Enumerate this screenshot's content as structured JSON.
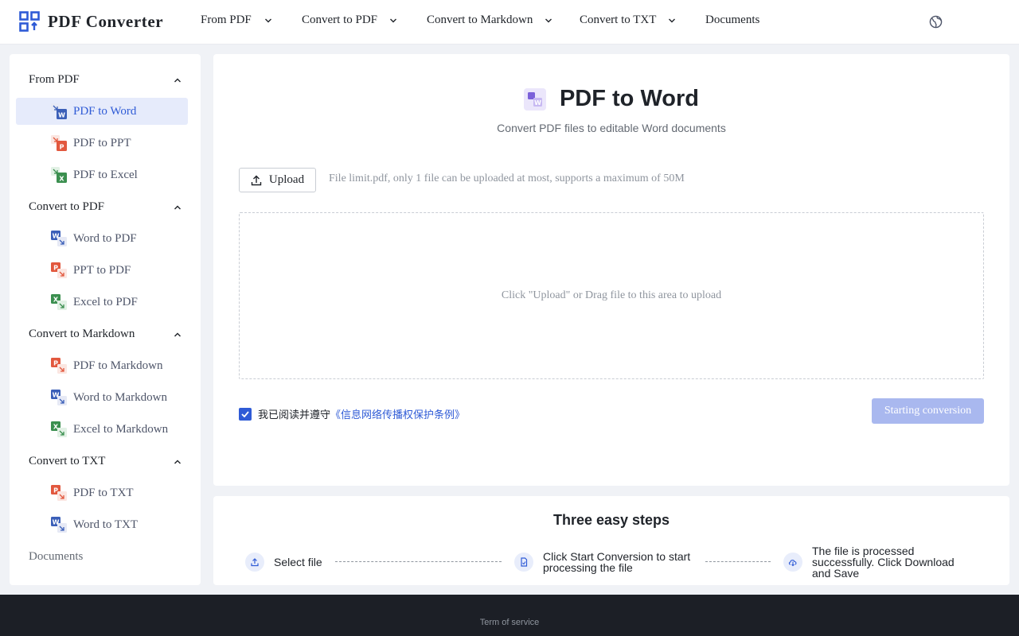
{
  "app": {
    "name": "PDF Converter"
  },
  "header": {
    "nav": [
      {
        "label": "From PDF",
        "has_dropdown": true
      },
      {
        "label": "Convert to PDF",
        "has_dropdown": true
      },
      {
        "label": "Convert to Markdown",
        "has_dropdown": true
      },
      {
        "label": "Convert to TXT",
        "has_dropdown": true
      },
      {
        "label": "Documents",
        "has_dropdown": false
      }
    ],
    "language_icon": "globe-icon"
  },
  "sidebar": {
    "groups": [
      {
        "label": "From PDF",
        "items": [
          {
            "label": "PDF to Word",
            "icon": "pdf-to-word-icon",
            "active": true
          },
          {
            "label": "PDF to PPT",
            "icon": "pdf-to-ppt-icon"
          },
          {
            "label": "PDF to Excel",
            "icon": "pdf-to-excel-icon"
          }
        ]
      },
      {
        "label": "Convert to PDF",
        "items": [
          {
            "label": "Word to PDF",
            "icon": "word-to-pdf-icon"
          },
          {
            "label": "PPT to PDF",
            "icon": "ppt-to-pdf-icon"
          },
          {
            "label": "Excel to PDF",
            "icon": "excel-to-pdf-icon"
          }
        ]
      },
      {
        "label": "Convert to Markdown",
        "items": [
          {
            "label": "PDF to Markdown",
            "icon": "pdf-to-markdown-icon"
          },
          {
            "label": "Word to Markdown",
            "icon": "word-to-markdown-icon"
          },
          {
            "label": "Excel to Markdown",
            "icon": "excel-to-markdown-icon"
          }
        ]
      },
      {
        "label": "Convert to TXT",
        "items": [
          {
            "label": "PDF to TXT",
            "icon": "pdf-to-txt-icon"
          },
          {
            "label": "Word to TXT",
            "icon": "word-to-txt-icon"
          }
        ]
      }
    ],
    "documents_label": "Documents"
  },
  "main": {
    "title": "PDF to Word",
    "subtitle": "Convert PDF files to editable Word documents",
    "upload_label": "Upload",
    "limit_text": "File limit.pdf, only 1 file can be uploaded at most, supports a maximum of 50M",
    "dropzone_text": "Click \"Upload\" or Drag file to this area to upload",
    "agree_text": "我已阅读并遵守",
    "agree_link": "《信息网络传播权保护条例》",
    "agree_checked": true,
    "start_label": "Starting conversion"
  },
  "steps": {
    "title": "Three easy steps",
    "items": [
      {
        "line1": "Select file",
        "line2": "",
        "line3": "",
        "icon": "upload-icon"
      },
      {
        "line1": "Click Start Conversion to start",
        "line2": "processing the file",
        "line3": "",
        "icon": "document-icon"
      },
      {
        "line1": "The file is processed",
        "line2": "successfully. Click Download",
        "line3": "and Save",
        "icon": "cloud-download-icon"
      }
    ]
  },
  "footer": {
    "link": "Term of service"
  },
  "colors": {
    "accent": "#2f5bd6",
    "active_bg": "#e6ebfb",
    "disabled_button": "#a9b8ef",
    "footer_bg": "#1c1f26",
    "word": "#3b5fb8",
    "ppt": "#e2583e",
    "excel": "#3b8f4f"
  }
}
